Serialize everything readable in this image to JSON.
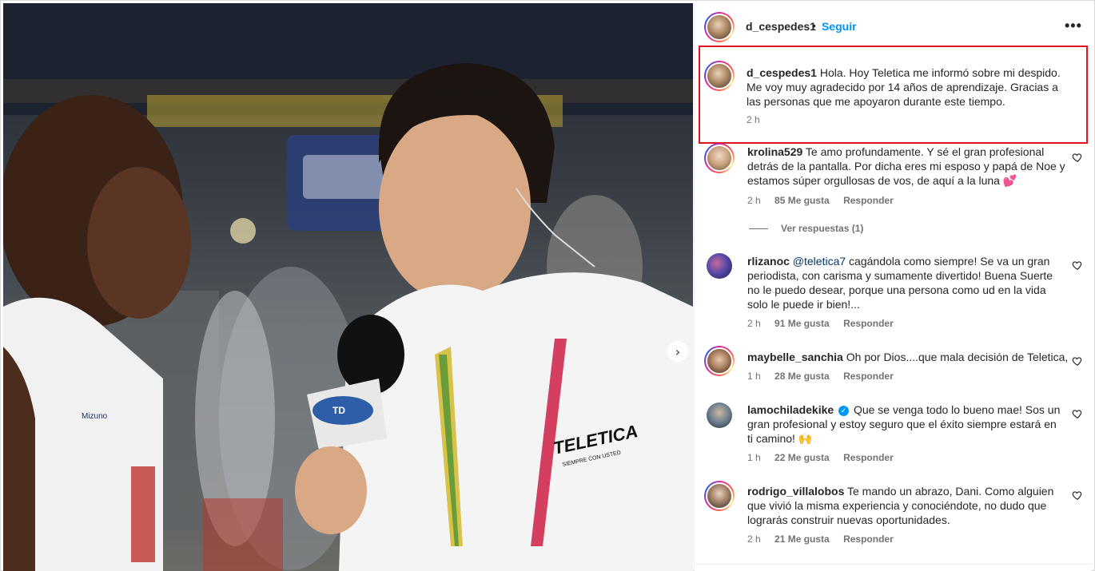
{
  "post": {
    "author": "d_cespedes1",
    "separator": "•",
    "follow_label": "Seguir",
    "more_label": "•••",
    "next_label": "›",
    "caption": {
      "username": "d_cespedes1",
      "lines": [
        "Hola. Hoy Teletica me informó sobre mi despido.",
        "Me voy muy agradecido por 14 años de aprendizaje. Gracias a",
        "las personas que me apoyaron durante este tiempo."
      ],
      "time": "2 h"
    }
  },
  "photo": {
    "mic_flag_text": "TD",
    "shirt_logo": "TELETICA",
    "shirt_logo_sub": "SIEMPRE CON USTED",
    "jersey_brand": "Mizuno"
  },
  "comments": [
    {
      "username": "krolina529",
      "lines": [
        "Te amo profundamente. Y sé el gran profesional",
        "detrás de la pantalla. Por dicha eres mi esposo y papá de Noe y",
        "estamos súper orgullosas de vos, de aquí a la luna 💕"
      ],
      "time": "2 h",
      "likes": "85 Me gusta",
      "reply": "Responder",
      "view_replies": "Ver respuestas (1)"
    },
    {
      "username": "rlizanoc",
      "mention": "@teletica7",
      "lines": [
        "cagándola como siempre! Se va un gran",
        "periodista, con carisma y sumamente divertido! Buena Suerte",
        "no le puedo desear, porque una persona como ud en la vida",
        "solo le puede ir bien!..."
      ],
      "time": "2 h",
      "likes": "91 Me gusta",
      "reply": "Responder"
    },
    {
      "username": "maybelle_sanchia",
      "lines": [
        "Oh por Dios....que mala decisión de Teletica,"
      ],
      "time": "1 h",
      "likes": "28 Me gusta",
      "reply": "Responder"
    },
    {
      "username": "lamochiladekike",
      "verified_mark": "✓",
      "lines": [
        "Que se venga todo lo bueno mae! Sos un",
        "gran profesional y estoy seguro que el éxito siempre estará en",
        "ti camino! 🙌"
      ],
      "time": "1 h",
      "likes": "22 Me gusta",
      "reply": "Responder"
    },
    {
      "username": "rodrigo_villalobos",
      "lines": [
        "Te mando un abrazo, Dani. Como alguien",
        "que vivió la misma experiencia y conociéndote, no dudo que",
        "lograrás construir nuevas oportunidades."
      ],
      "time": "2 h",
      "likes": "21 Me gusta",
      "reply": "Responder"
    }
  ],
  "colors": {
    "link_blue": "#0095f6",
    "highlight_red": "#e0141e",
    "mention_blue": "#00376b",
    "meta_gray": "#737373"
  }
}
